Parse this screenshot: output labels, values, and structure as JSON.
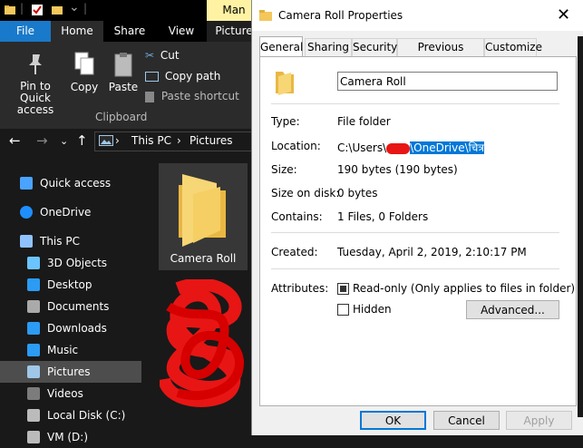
{
  "explorer": {
    "titlebar": {
      "manage_tab": "Man"
    },
    "tabs": {
      "file": "File",
      "home": "Home",
      "share": "Share",
      "view": "View",
      "picture": "Picture"
    },
    "ribbon": {
      "pin_label": "Pin to Quick access",
      "copy_label": "Copy",
      "paste_label": "Paste",
      "cut_label": "Cut",
      "copy_path_label": "Copy path",
      "paste_shortcut_label": "Paste shortcut",
      "clipboard_group": "Clipboard"
    },
    "address": {
      "crumbs": [
        "This PC",
        "Pictures"
      ]
    },
    "nav": [
      {
        "label": "Quick access",
        "icon": "star-icon",
        "color": "#4aa3ff"
      },
      {
        "label": "OneDrive",
        "icon": "cloud-icon",
        "color": "#1f8fff"
      },
      {
        "label": "This PC",
        "icon": "computer-icon",
        "color": "#8fc3ff"
      },
      {
        "label": "3D Objects",
        "icon": "cube-icon",
        "color": "#6cc4ff"
      },
      {
        "label": "Desktop",
        "icon": "desktop-icon",
        "color": "#2b9bf4"
      },
      {
        "label": "Documents",
        "icon": "document-icon",
        "color": "#aaaaaa"
      },
      {
        "label": "Downloads",
        "icon": "download-arrow-icon",
        "color": "#2b9bf4"
      },
      {
        "label": "Music",
        "icon": "music-note-icon",
        "color": "#2b9bf4"
      },
      {
        "label": "Pictures",
        "icon": "pictures-icon",
        "color": "#9fc7e8",
        "selected": true
      },
      {
        "label": "Videos",
        "icon": "film-icon",
        "color": "#7c7c7c"
      },
      {
        "label": "Local Disk (C:)",
        "icon": "drive-icon",
        "color": "#bbbbbb"
      },
      {
        "label": "VM (D:)",
        "icon": "drive-icon",
        "color": "#bbbbbb"
      }
    ],
    "folder": {
      "label": "Camera Roll"
    }
  },
  "dialog": {
    "title": "Camera Roll Properties",
    "tabs": [
      "General",
      "Sharing",
      "Security",
      "Previous Versions",
      "Customize"
    ],
    "active_tab": "General",
    "name_value": "Camera Roll",
    "rows": {
      "type_label": "Type:",
      "type_value": "File folder",
      "location_label": "Location:",
      "location_prefix": "C:\\Users\\",
      "location_selected": "\\OneDrive\\चित्र",
      "size_label": "Size:",
      "size_value": "190 bytes (190 bytes)",
      "size_on_disk_label": "Size on disk:",
      "size_on_disk_value": "0 bytes",
      "contains_label": "Contains:",
      "contains_value": "1 Files, 0 Folders",
      "created_label": "Created:",
      "created_value": "Tuesday, April 2, 2019, 2:10:17 PM",
      "attributes_label": "Attributes:"
    },
    "attributes": {
      "readonly_label": "Read-only (Only applies to files in folder)",
      "readonly_state": "indeterminate",
      "hidden_label": "Hidden",
      "hidden_checked": false,
      "advanced_label": "Advanced..."
    },
    "buttons": {
      "ok": "OK",
      "cancel": "Cancel",
      "apply": "Apply"
    }
  }
}
